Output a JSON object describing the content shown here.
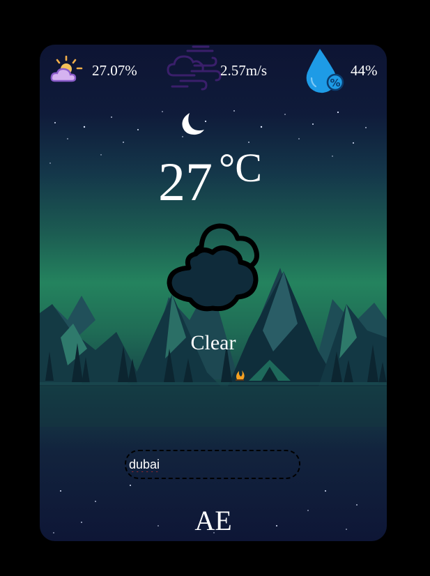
{
  "stats": {
    "cloudiness": {
      "value": "27.07%",
      "icon": "partly-cloudy-sun-icon"
    },
    "wind": {
      "value": "2.57m/s",
      "icon": "wind-cloud-icon"
    },
    "humidity": {
      "value": "44%",
      "icon": "humidity-drop-icon"
    }
  },
  "moon_icon": "crescent-moon-icon",
  "temperature": {
    "value": "27",
    "unit": "°C"
  },
  "weather_icon": "clouds-icon",
  "condition": "Clear",
  "search": {
    "value": "dubai",
    "placeholder": ""
  },
  "country": "AE",
  "colors": {
    "sky_top": "#0d1433",
    "aurora_green": "#24835e",
    "mountain_dark": "#0f2a33",
    "humidity_blue": "#1e9be6",
    "wind_purple": "#3a1f6b",
    "text": "#ffffff"
  }
}
